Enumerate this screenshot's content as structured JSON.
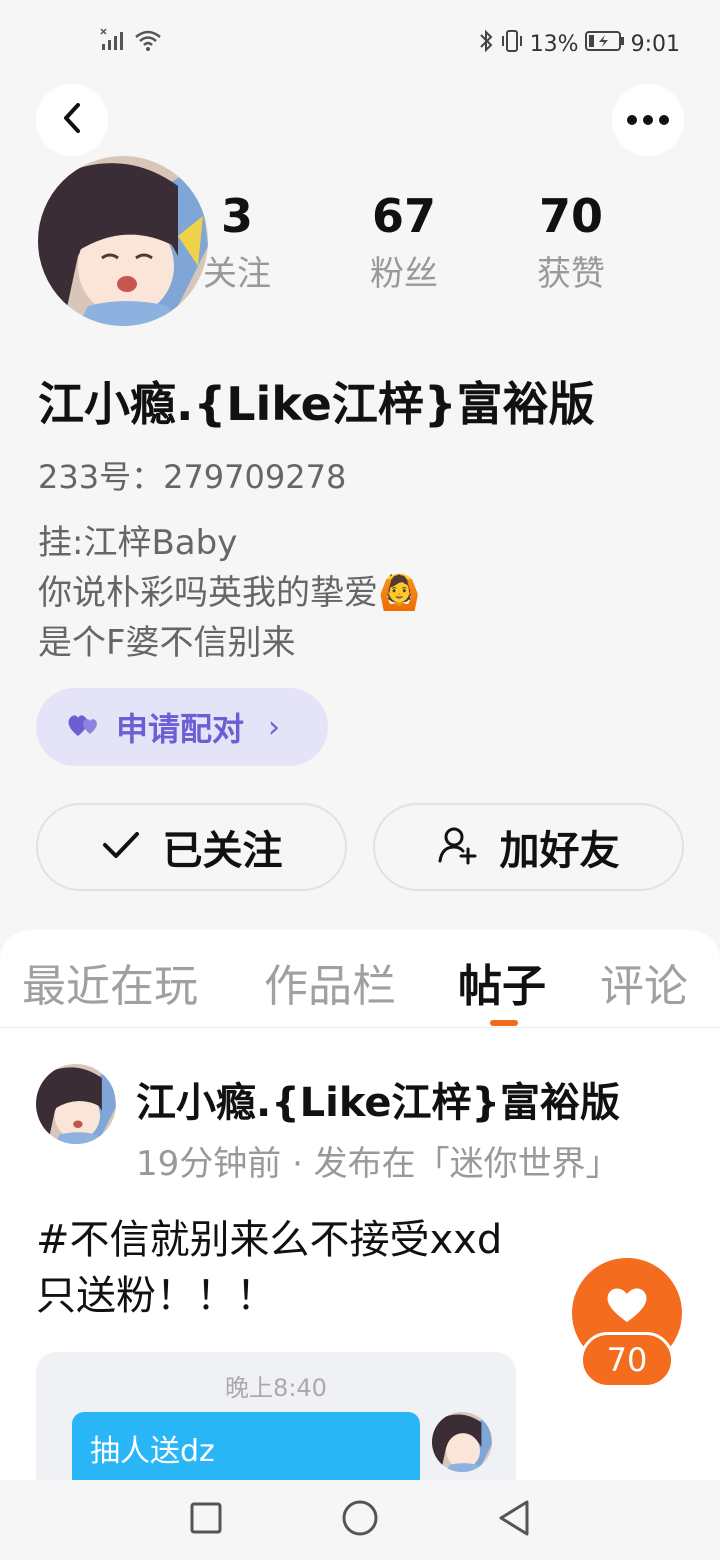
{
  "status_bar": {
    "battery": "13%",
    "time": "9:01"
  },
  "profile": {
    "stats": [
      {
        "value": "3",
        "label": "关注"
      },
      {
        "value": "67",
        "label": "粉丝"
      },
      {
        "value": "70",
        "label": "获赞"
      }
    ],
    "username": "江小瘾.{Like江梓}富裕版",
    "uid": "233号：279709278",
    "bio": "挂:江梓Baby\n你说朴彩吗英我的挚爱🙆\n是个F婆不信别来",
    "pair_button": "申请配对",
    "follow_button": "已关注",
    "add_friend_button": "加好友"
  },
  "tabs": [
    "最近在玩",
    "作品栏",
    "帖子",
    "评论"
  ],
  "active_tab": "帖子",
  "post": {
    "author": "江小瘾.{Like江梓}富裕版",
    "meta": "19分钟前 · 发布在「迷你世界」",
    "text": "#不信就别来么不接受xxd\n只送粉！！！",
    "like_count": "70",
    "image": {
      "time": "晚上8:40",
      "bubble_text": "抽人送dz"
    }
  },
  "colors": {
    "accent": "#f46c1e",
    "pair_bg": "#e5e3f8",
    "pair_fg": "#6d5fd3",
    "chat_bubble": "#29b6f6"
  }
}
